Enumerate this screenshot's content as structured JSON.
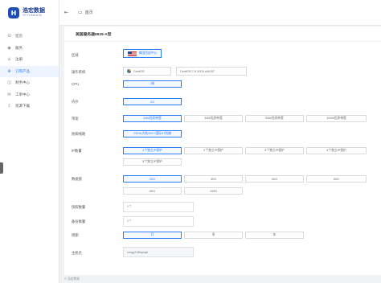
{
  "brand": {
    "name_cn": "浩宏数据",
    "name_en": "HTYUNDATA",
    "mark": "H"
  },
  "header": {
    "home_label": "首页"
  },
  "sidebar": {
    "items": [
      {
        "label": "首页",
        "icon": "home-icon",
        "glyph": "☷"
      },
      {
        "label": "服务",
        "icon": "globe-icon",
        "glyph": "◉"
      },
      {
        "label": "注册",
        "icon": "user-icon",
        "glyph": "♙"
      },
      {
        "label": "订购产品",
        "icon": "cart-icon",
        "glyph": "⊕"
      },
      {
        "label": "财务中心",
        "icon": "wallet-icon",
        "glyph": "◫"
      },
      {
        "label": "工单中心",
        "icon": "ticket-icon",
        "glyph": "✉"
      },
      {
        "label": "资源下载",
        "icon": "download-icon",
        "glyph": "⇩"
      }
    ],
    "active_index": 3
  },
  "page": {
    "title": "美国服务器8929-A型",
    "region": {
      "label": "区域",
      "value": "美国西部中心"
    },
    "os": {
      "label": "操作系统",
      "family": "CentOS",
      "version": "CentOS-7.6.2003-x64-BT"
    },
    "cpu": {
      "label": "CPU",
      "options": [
        "2核"
      ]
    },
    "ram": {
      "label": "内存",
      "options": [
        "2G"
      ]
    },
    "bandwidth": {
      "label": "带宽",
      "options": [
        "20M优质带宽",
        "30M优质带宽",
        "50M优质带宽",
        "100M优质带宽"
      ]
    },
    "ddos": {
      "label": "防御线路",
      "options": [
        "CERA大陆20G+国际3T防御"
      ]
    },
    "ip": {
      "label": "IP数量",
      "options": [
        "1个独立IP保护",
        "2个独立IP保护",
        "3个独立IP保护",
        "4个独立IP保护",
        "5个独立IP保护"
      ]
    },
    "disk": {
      "label": "数据盘",
      "options": [
        "20G",
        "30G",
        "40G",
        "50G",
        "60G",
        "100G"
      ]
    },
    "snapshot": {
      "label": "快照数量",
      "value": "0个"
    },
    "backup": {
      "label": "备份数量",
      "value": "0个"
    },
    "cycle": {
      "label": "周期",
      "options": [
        "月",
        "季",
        "年"
      ]
    },
    "hostname": {
      "label": "主机名",
      "value": "xergg7d6lqmqb"
    }
  },
  "footer": {
    "copyright": "© 浩宏数据"
  },
  "colors": {
    "accent": "#2d7df6",
    "brand": "#1d4fb3"
  }
}
